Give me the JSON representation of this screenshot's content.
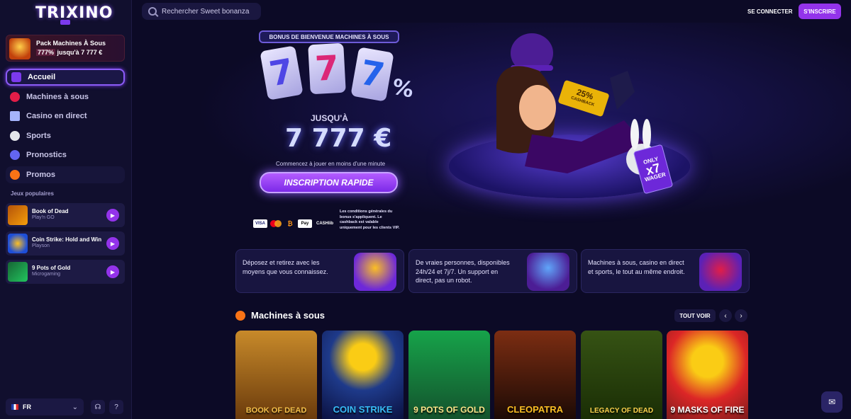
{
  "brand": {
    "logo": "TRIXINO"
  },
  "sidebar": {
    "promo": {
      "title": "Pack Machines À Sous",
      "percent": "777%",
      "amount": "jusqu'à 7 777 €"
    },
    "nav": [
      {
        "label": "Accueil",
        "active": true,
        "icon": "top-hat-icon"
      },
      {
        "label": "Machines à sous",
        "icon": "cherry-icon"
      },
      {
        "label": "Casino en direct",
        "icon": "cards-icon"
      },
      {
        "label": "Sports",
        "icon": "soccer-ball-icon"
      },
      {
        "label": "Pronostics",
        "icon": "globe-icon"
      },
      {
        "label": "Promos",
        "icon": "promo-icon"
      }
    ],
    "popular_title": "Jeux populaires",
    "popular": [
      {
        "title": "Book of Dead",
        "provider": "Play'n GO"
      },
      {
        "title": "Coin Strike: Hold and Win",
        "provider": "Playson"
      },
      {
        "title": "9 Pots of Gold",
        "provider": "Microgaming"
      }
    ],
    "language": "FR"
  },
  "header": {
    "search_placeholder": "Rechercher Sweet bonanza",
    "login": "SE CONNECTER",
    "signup": "S'INSCRIRE"
  },
  "hero": {
    "badge": "BONUS DE BIENVENUE MACHINES À SOUS",
    "sevens": [
      "7",
      "7",
      "7"
    ],
    "percent": "%",
    "upto": "JUSQU'À",
    "amount": "7 777 €",
    "start_line": "Commencez à jouer en moins d'une minute",
    "cta": "INSCRIPTION RAPIDE",
    "payments": [
      "VISA",
      "MC",
      "BTC",
      "Pay",
      "CASHlib"
    ],
    "terms": "Les conditions générales du bonus s'appliquent. Le cashback est valable uniquement pour les clients VIP.",
    "cashback_pct": "25%",
    "cashback_label": "CASHBACK",
    "wager_top": "ONLY",
    "wager_mult": "x7",
    "wager_label": "WAGER"
  },
  "features": [
    {
      "text": "Déposez et retirez avec les moyens que vous connaissez."
    },
    {
      "text": "De vraies personnes, disponibles 24h/24 et 7j/7. Un support en direct, pas un robot."
    },
    {
      "text": "Machines à sous, casino en direct et sports, le tout au même endroit."
    }
  ],
  "machines": {
    "title": "Machines à sous",
    "see_all": "TOUT VOIR",
    "games": [
      {
        "name": "BOOK OF DEAD"
      },
      {
        "name": "COIN STRIKE"
      },
      {
        "name": "9 POTS OF GOLD"
      },
      {
        "name": "CLEOPATRA"
      },
      {
        "name": "LEGACY OF DEAD"
      },
      {
        "name": "9 MASKS OF FIRE"
      }
    ]
  },
  "colors": {
    "accent": "#9333ea",
    "background": "#0c0a26",
    "sidebar": "#110f2e"
  }
}
